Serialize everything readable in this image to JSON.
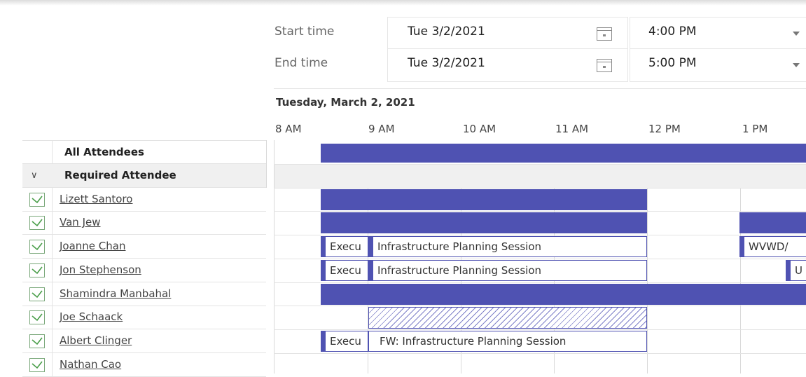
{
  "times": {
    "start_label": "Start time",
    "end_label": "End time",
    "start_date": "Tue 3/2/2021",
    "end_date": "Tue 3/2/2021",
    "start_time": "4:00 PM",
    "end_time": "5:00 PM",
    "calendar_icon": "calendar-icon",
    "dropdown_icon": "chevron-down-icon"
  },
  "schedule": {
    "day_header": "Tuesday, March 2, 2021",
    "hours": [
      "8 AM",
      "9 AM",
      "10 AM",
      "11 AM",
      "12 PM",
      "1 PM"
    ],
    "busy_color": "#4f52b2"
  },
  "attendees": {
    "all_label": "All Attendees",
    "required_label": "Required Attendee",
    "people": [
      "Lizett Santoro",
      "Van Jew",
      "Joanne Chan",
      "Jon Stephenson",
      "Shamindra Manbahal",
      "Joe Schaack",
      "Albert Clinger",
      "Nathan Cao"
    ]
  },
  "events": {
    "exec": "Execu",
    "infra": "Infrastructure Planning Session",
    "fw_infra": "FW: Infrastructure Planning Session",
    "wvwd": "WVWD/",
    "u": "U"
  }
}
